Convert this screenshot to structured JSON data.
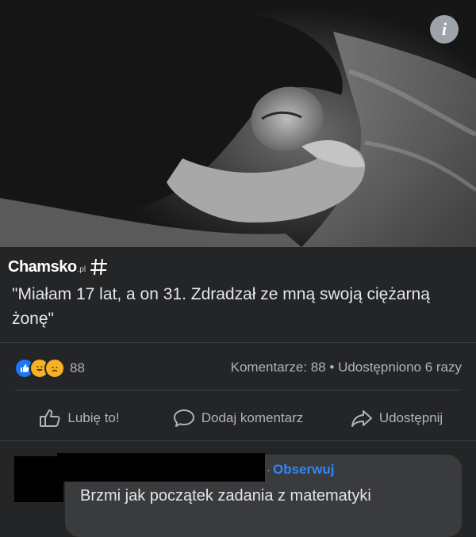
{
  "photo": {
    "alt": "black-and-white photo of a woman lying down"
  },
  "brand": {
    "name": "Chamsko",
    "tld": ".pl"
  },
  "post": {
    "caption": "\"Miałam 17 lat, a on 31. Zdradzał ze mną swoją ciężarną żonę\"",
    "reaction_count": "88",
    "comments_stat": "Komentarze: 88",
    "separator": "•",
    "shares_stat": "Udostępniono 6 razy"
  },
  "actions": {
    "like": "Lubię to!",
    "comment": "Dodaj komentarz",
    "share": "Udostępnij"
  },
  "comment": {
    "follow": "Obserwuj",
    "text": "Brzmi jak początek zadania z matematyki"
  },
  "colors": {
    "link": "#2d88ff",
    "background": "#242526",
    "text": "#e4e6eb",
    "muted": "#b0b3b8"
  }
}
